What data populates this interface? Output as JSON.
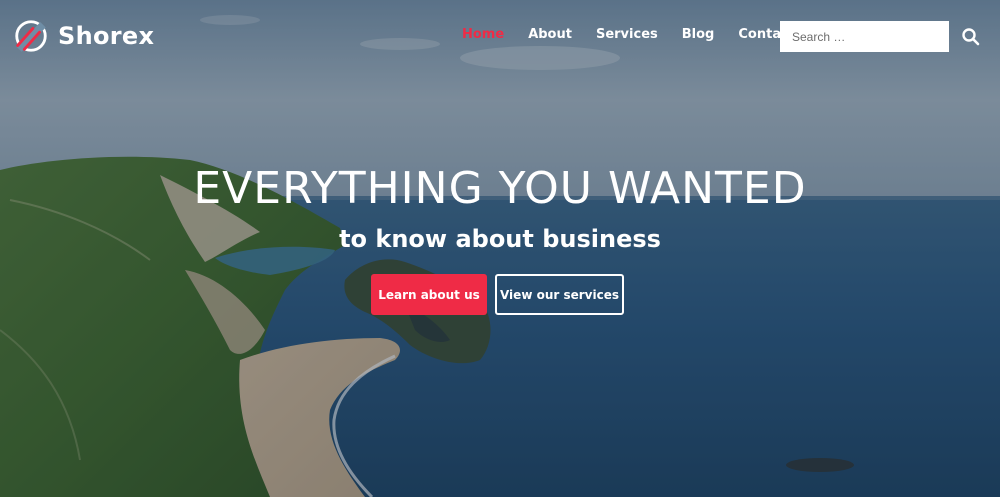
{
  "brand": {
    "name": "Shorex",
    "accent_color": "#ef2b46"
  },
  "nav": {
    "items": [
      {
        "label": "Home",
        "active": true
      },
      {
        "label": "About",
        "active": false
      },
      {
        "label": "Services",
        "active": false
      },
      {
        "label": "Blog",
        "active": false
      },
      {
        "label": "Contacts",
        "active": false
      }
    ]
  },
  "search": {
    "placeholder": "Search …",
    "icon": "search-icon"
  },
  "hero": {
    "headline": "EVERYTHING YOU WANTED",
    "subheadline": "to know about business",
    "primary_button": "Learn about us",
    "secondary_button": "View our services",
    "background": "coastal-cliffs-and-sea-photo"
  }
}
